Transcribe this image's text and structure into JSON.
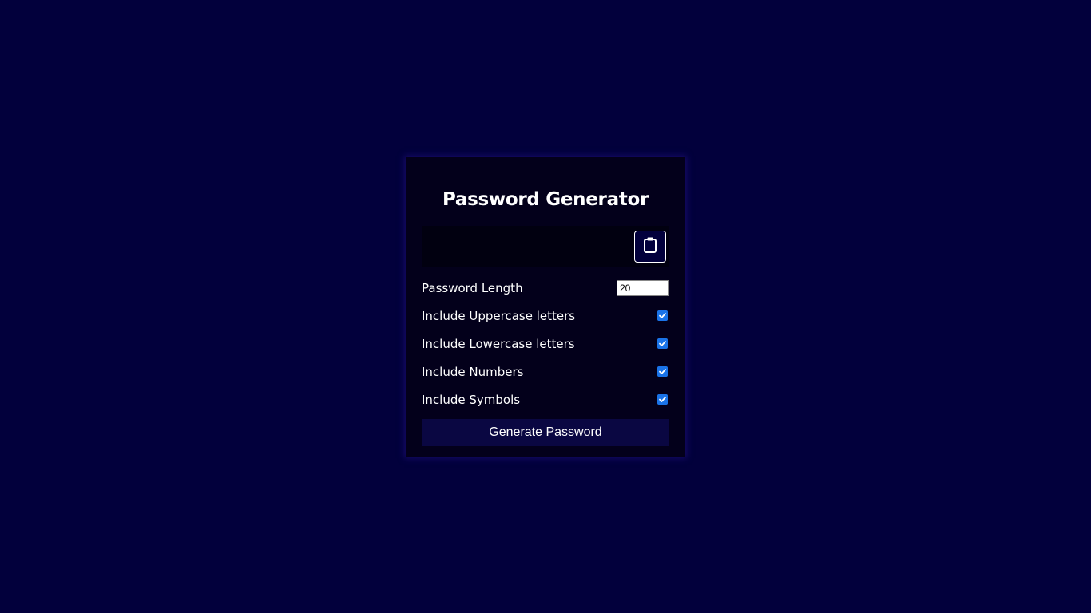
{
  "app": {
    "title": "Password Generator"
  },
  "result": {
    "password": ""
  },
  "icons": {
    "clipboard": "clipboard-icon",
    "checkbox_checked": "checkmark-icon"
  },
  "settings": {
    "length": {
      "label": "Password Length",
      "value": "20"
    },
    "uppercase": {
      "label": "Include Uppercase letters",
      "checked": true
    },
    "lowercase": {
      "label": "Include Lowercase letters",
      "checked": true
    },
    "numbers": {
      "label": "Include Numbers",
      "checked": true
    },
    "symbols": {
      "label": "Include Symbols",
      "checked": true
    }
  },
  "actions": {
    "generate_label": "Generate Password"
  },
  "colors": {
    "background": "#02003c",
    "card": "#03001b",
    "result_box": "#010010",
    "button": "#0a0742",
    "checkbox": "#1a73e8"
  }
}
